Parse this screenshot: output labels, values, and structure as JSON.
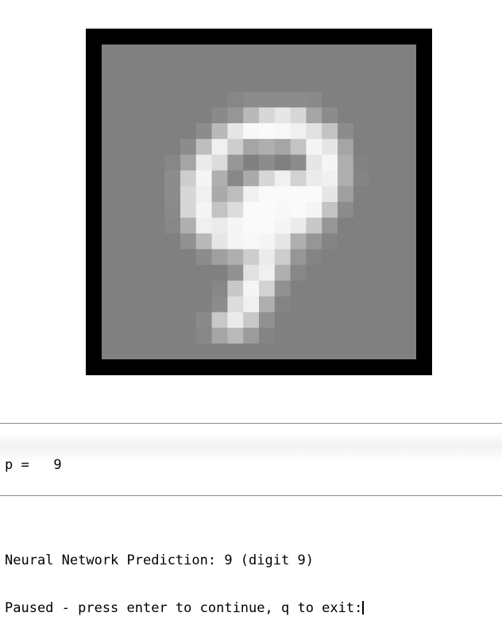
{
  "image": {
    "grid_size": 20,
    "background_gray": 128,
    "description_label": "digit-9-sample",
    "pixels": [
      [
        128,
        128,
        128,
        128,
        128,
        128,
        128,
        128,
        128,
        128,
        128,
        128,
        128,
        128,
        128,
        128,
        128,
        128,
        128,
        128
      ],
      [
        128,
        128,
        128,
        128,
        128,
        128,
        128,
        128,
        128,
        128,
        128,
        128,
        128,
        128,
        128,
        128,
        128,
        128,
        128,
        128
      ],
      [
        128,
        128,
        128,
        128,
        128,
        128,
        128,
        128,
        128,
        128,
        128,
        128,
        128,
        128,
        128,
        128,
        128,
        128,
        128,
        128
      ],
      [
        128,
        128,
        128,
        128,
        128,
        128,
        128,
        128,
        135,
        140,
        140,
        140,
        140,
        138,
        128,
        128,
        128,
        128,
        128,
        128
      ],
      [
        128,
        128,
        128,
        128,
        128,
        128,
        128,
        138,
        150,
        185,
        215,
        230,
        215,
        165,
        140,
        128,
        128,
        128,
        128,
        128
      ],
      [
        128,
        128,
        128,
        128,
        128,
        128,
        140,
        185,
        230,
        248,
        250,
        248,
        240,
        225,
        195,
        140,
        128,
        128,
        128,
        128
      ],
      [
        128,
        128,
        128,
        128,
        128,
        140,
        190,
        240,
        205,
        165,
        175,
        165,
        195,
        245,
        230,
        165,
        128,
        128,
        128,
        128
      ],
      [
        128,
        128,
        128,
        128,
        135,
        165,
        235,
        220,
        150,
        128,
        140,
        128,
        140,
        230,
        245,
        175,
        130,
        128,
        128,
        128
      ],
      [
        128,
        128,
        128,
        128,
        140,
        205,
        245,
        175,
        135,
        170,
        215,
        240,
        210,
        235,
        240,
        175,
        132,
        128,
        128,
        128
      ],
      [
        128,
        128,
        128,
        128,
        140,
        215,
        240,
        170,
        190,
        240,
        250,
        250,
        250,
        250,
        230,
        160,
        128,
        128,
        128,
        128
      ],
      [
        128,
        128,
        128,
        128,
        138,
        215,
        245,
        195,
        220,
        250,
        250,
        248,
        250,
        245,
        195,
        140,
        128,
        128,
        128,
        128
      ],
      [
        128,
        128,
        128,
        128,
        135,
        175,
        240,
        235,
        245,
        250,
        250,
        245,
        235,
        200,
        150,
        128,
        128,
        128,
        128,
        128
      ],
      [
        128,
        128,
        128,
        128,
        128,
        145,
        185,
        230,
        245,
        248,
        245,
        230,
        175,
        150,
        132,
        128,
        128,
        128,
        128,
        128
      ],
      [
        128,
        128,
        128,
        128,
        128,
        128,
        140,
        160,
        175,
        205,
        235,
        205,
        150,
        132,
        128,
        128,
        128,
        128,
        128,
        128
      ],
      [
        128,
        128,
        128,
        128,
        128,
        128,
        128,
        128,
        145,
        225,
        240,
        175,
        135,
        128,
        128,
        128,
        128,
        128,
        128,
        128
      ],
      [
        128,
        128,
        128,
        128,
        128,
        128,
        128,
        135,
        200,
        245,
        210,
        145,
        128,
        128,
        128,
        128,
        128,
        128,
        128,
        128
      ],
      [
        128,
        128,
        128,
        128,
        128,
        128,
        128,
        140,
        220,
        240,
        175,
        132,
        128,
        128,
        128,
        128,
        128,
        128,
        128,
        128
      ],
      [
        128,
        128,
        128,
        128,
        128,
        128,
        138,
        200,
        235,
        200,
        145,
        128,
        128,
        128,
        128,
        128,
        128,
        128,
        128,
        128
      ],
      [
        128,
        128,
        128,
        128,
        128,
        128,
        135,
        165,
        185,
        155,
        132,
        128,
        128,
        128,
        128,
        128,
        128,
        128,
        128,
        128
      ],
      [
        128,
        128,
        128,
        128,
        128,
        128,
        128,
        128,
        128,
        128,
        128,
        128,
        128,
        128,
        128,
        128,
        128,
        128,
        128,
        128
      ]
    ]
  },
  "console": {
    "line1": "p =   9",
    "line2": "",
    "line3": "Neural Network Prediction: 9 (digit 9)",
    "line4": "Paused - press enter to continue, q to exit:"
  }
}
